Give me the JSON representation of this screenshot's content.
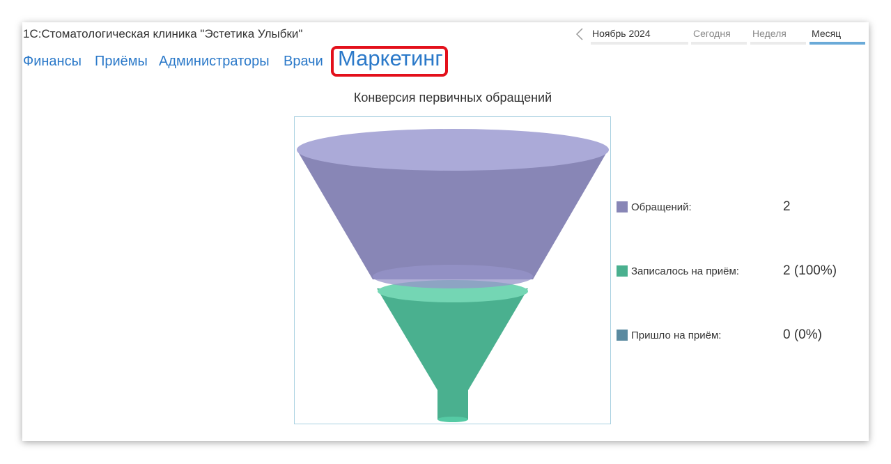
{
  "app": {
    "title": "1С:Стоматологическая клиника \"Эстетика Улыбки\""
  },
  "period": {
    "prev_icon": "chevron-left-icon",
    "current": "Ноябрь 2024",
    "buttons": [
      {
        "label": "Сегодня",
        "active": false
      },
      {
        "label": "Неделя",
        "active": false
      },
      {
        "label": "Месяц",
        "active": true
      }
    ]
  },
  "tabs": [
    {
      "label": "Финансы",
      "active": false
    },
    {
      "label": "Приёмы",
      "active": false
    },
    {
      "label": "Администраторы",
      "active": false
    },
    {
      "label": "Врачи",
      "active": false
    },
    {
      "label": "Маркетинг",
      "active": true
    }
  ],
  "colors": {
    "tab_link": "#2b79c9",
    "highlight": "#e3101b",
    "stage1": "#8886b6",
    "stage2": "#4ab08f",
    "stage3": "#5a8aa0"
  },
  "chart_data": {
    "type": "funnel",
    "title": "Конверсия первичных обращений",
    "stages": [
      {
        "label": "Обращений:",
        "value": 2,
        "display": "2",
        "color": "#8886b6"
      },
      {
        "label": "Записалось на приём:",
        "value": 2,
        "display": "2 (100%)",
        "color": "#4ab08f"
      },
      {
        "label": "Пришло на приём:",
        "value": 0,
        "display": "0 (0%)",
        "color": "#5a8aa0"
      }
    ]
  }
}
